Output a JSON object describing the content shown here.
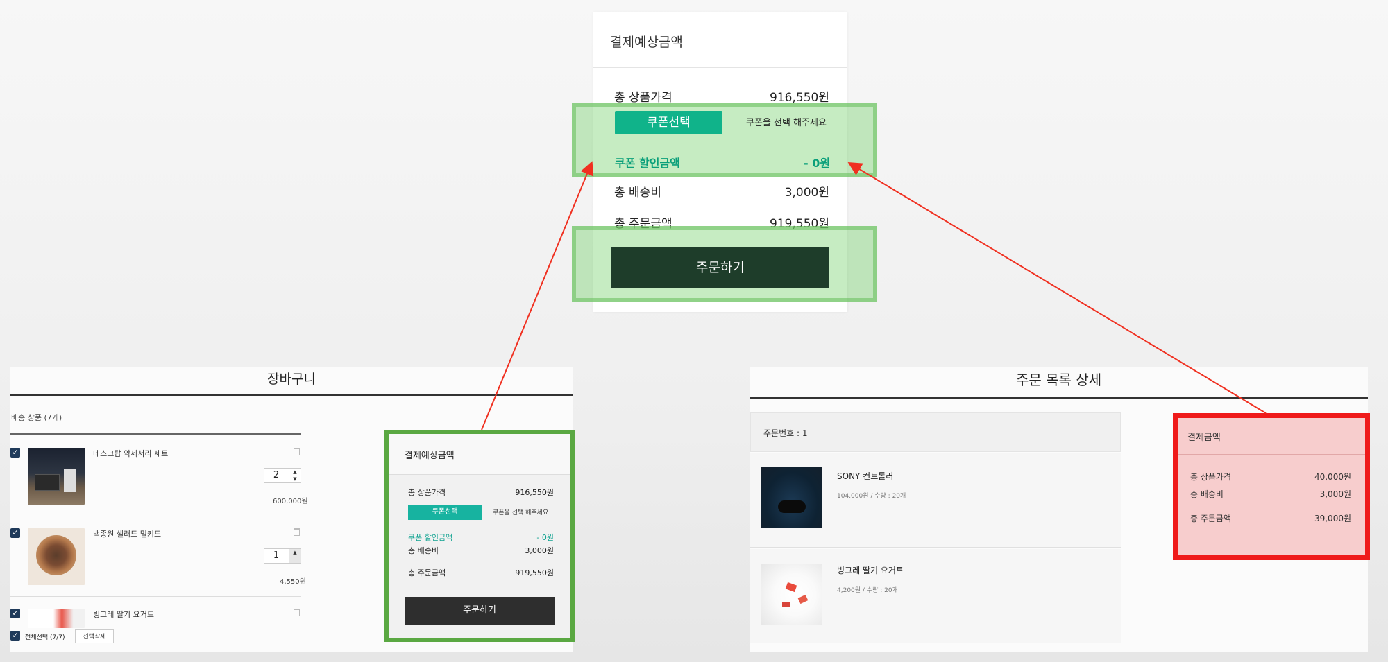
{
  "top_summary": {
    "title": "결제예상금액",
    "total_product_label": "총 상품가격",
    "total_product_value": "916,550원",
    "coupon_button": "쿠폰선택",
    "coupon_hint": "쿠폰을 선택 해주세요",
    "coupon_discount_label": "쿠폰 할인금액",
    "coupon_discount_value": "- 0원",
    "shipping_label": "총 배송비",
    "shipping_value": "3,000원",
    "order_total_label": "총 주문금액",
    "order_total_value": "919,550원",
    "order_button": "주문하기"
  },
  "cart": {
    "title": "장바구니",
    "shipping_items_label": "배송 상품 (7개)",
    "items": [
      {
        "name": "데스크탑 악세서리 세트",
        "qty": "2",
        "price": "600,000원"
      },
      {
        "name": "백종원 샐러드 밀키드",
        "qty": "1",
        "price": "4,550원"
      },
      {
        "name": "빙그레 딸기 요거트"
      }
    ],
    "select_all_label": "전체선택 (7/7)",
    "delete_selected_button": "선택삭제",
    "summary": {
      "title": "결제예상금액",
      "total_product_label": "총 상품가격",
      "total_product_value": "916,550원",
      "coupon_button": "쿠폰선택",
      "coupon_hint": "쿠폰을 선택 해주세요",
      "coupon_discount_label": "쿠폰 할인금액",
      "coupon_discount_value": "- 0원",
      "shipping_label": "총 배송비",
      "shipping_value": "3,000원",
      "order_total_label": "총 주문금액",
      "order_total_value": "919,550원",
      "order_button": "주문하기"
    }
  },
  "order_detail": {
    "title": "주문 목록 상세",
    "order_number_label": "주문번호 : 1",
    "items": [
      {
        "name": "SONY 컨트롤러",
        "meta": "104,000원 / 수량 : 20개"
      },
      {
        "name": "빙그레 딸기 요거트",
        "meta": "4,200원 / 수량 : 20개"
      }
    ],
    "payment": {
      "title": "결제금액",
      "total_product_label": "총 상품가격",
      "total_product_value": "40,000원",
      "shipping_label": "총 배송비",
      "shipping_value": "3,000원",
      "order_total_label": "총 주문금액",
      "order_total_value": "39,000원"
    }
  },
  "colors": {
    "highlight_green": "#78d26e",
    "highlight_red": "#ef1a1a",
    "coupon_teal": "#10b38a",
    "arrow_red": "#f03020"
  }
}
